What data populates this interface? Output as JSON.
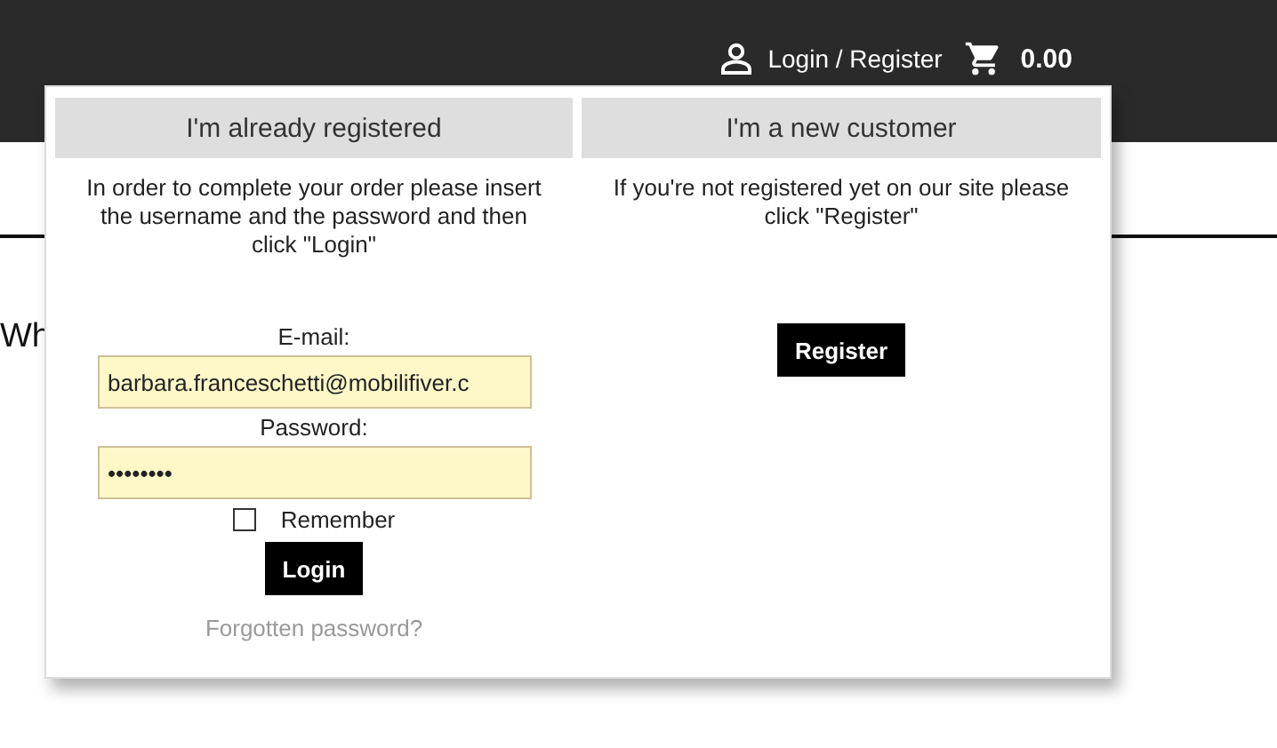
{
  "header": {
    "account_link": "Login / Register",
    "cart_total": "0.00"
  },
  "page": {
    "heading_fragment": "Wh"
  },
  "login_popup": {
    "existing": {
      "title": "I'm already registered",
      "intro": "In order to complete your order please insert the username and the password and then click \"Login\"",
      "email_label": "E-mail:",
      "email_value": "barbara.franceschetti@mobilifiver.c",
      "password_label": "Password:",
      "password_value": "••••••••",
      "remember": {
        "label": "Remember",
        "checked": false
      },
      "login_button": "Login",
      "forgot_link": "Forgotten password?"
    },
    "new": {
      "title": "I'm a new customer",
      "intro": "If you're not registered yet on our site please click \"Register\"",
      "register_button": "Register"
    }
  }
}
